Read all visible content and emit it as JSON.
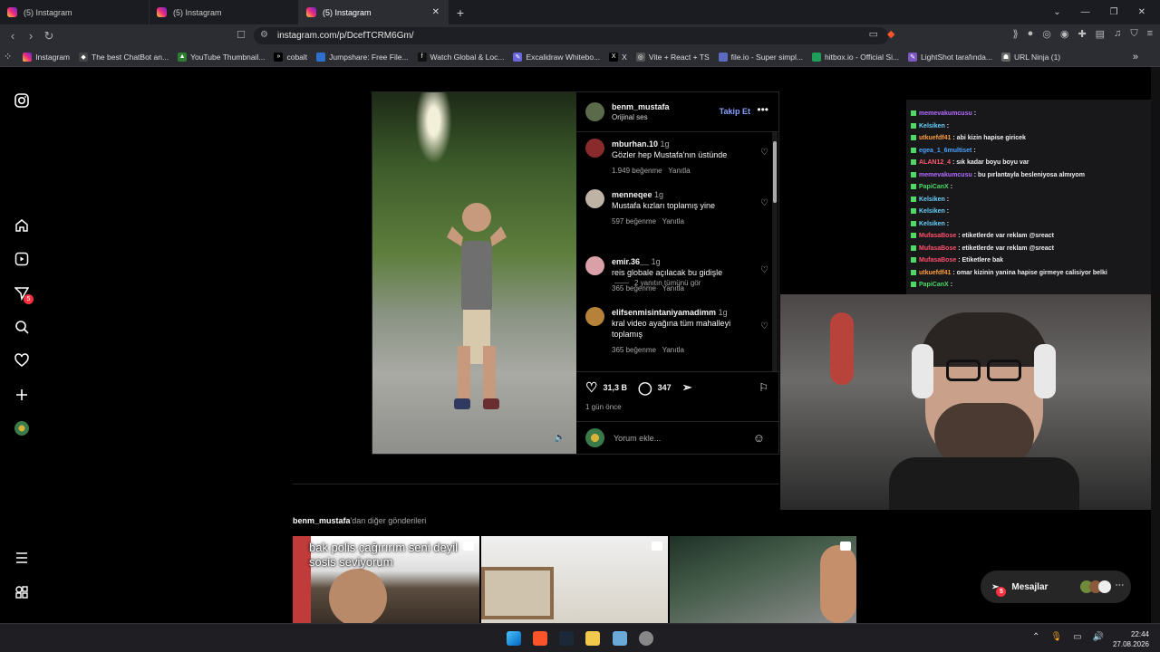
{
  "browser": {
    "tabs": [
      {
        "title": "(5) Instagram"
      },
      {
        "title": "(5) Instagram"
      },
      {
        "title": "(5) Instagram"
      }
    ],
    "url": "instagram.com/p/DcefTCRM6Gm/",
    "bookmarks": [
      "Instagram",
      "The best ChatBot an...",
      "YouTube Thumbnail...",
      "cobalt",
      "Jumpshare: Free File...",
      "Watch Global & Loc...",
      "Excalidraw Whitebo...",
      "X",
      "Vite + React + TS",
      "file.io - Super simpl...",
      "hitbox.io - Official Si...",
      "LightShot tarafında...",
      "URL Ninja (1)"
    ]
  },
  "sidebar": {
    "notif_badge": "5"
  },
  "post": {
    "author": "benm_mustafa",
    "audio": "Orijinal ses",
    "follow_label": "Takip Et",
    "comments": [
      {
        "user": "mburhan.10",
        "time": "1g",
        "text": "Gözler hep Mustafa'nın üstünde",
        "likes": "1.949 beğenme",
        "reply": "Yanıtla"
      },
      {
        "user": "menneqee",
        "time": "1g",
        "text": "Mustafa kızları toplamış yine",
        "likes": "597 beğenme",
        "reply": "Yanıtla"
      },
      {
        "user": "emir.36__",
        "time": "1g",
        "text": "reis globale açılacak bu gidişle",
        "likes": "365 beğenme",
        "reply": "Yanıtla"
      },
      {
        "user": "elifsenmisintaniyamadimm",
        "time": "1g",
        "text": "kral video ayağına tüm mahalleyi toplamış",
        "likes": "365 beğenme",
        "reply": "Yanıtla"
      }
    ],
    "view_replies": "2 yanıtın tümünü gör",
    "like_count": "31,3 B",
    "comment_count": "347",
    "ago": "1 gün önce",
    "comment_placeholder": "Yorum ekle..."
  },
  "more_posts": {
    "user": "benm_mustafa",
    "suffix": "'dan diğer gönderileri",
    "thumb1_text": "bak polis çağırırım seni deyil sosis seviyorum"
  },
  "stream_chat": [
    {
      "user": "memevakumcusu",
      "msg": ":",
      "color": "#b46bff"
    },
    {
      "user": "Kelsiken",
      "msg": ":",
      "color": "#6ad1ff"
    },
    {
      "user": "utkuefdf41",
      "msg": ": abi kizin hapise giricek",
      "color": "#ff9c3b"
    },
    {
      "user": "egea_1_6multiset",
      "msg": ":",
      "color": "#4aa3ff"
    },
    {
      "user": "ALAN12_4",
      "msg": ": sık kadar boyu boyu var",
      "color": "#ff5b6e"
    },
    {
      "user": "memevakumcusu",
      "msg": ": bu pırlantayla besleniyosa almıyom",
      "color": "#b46bff"
    },
    {
      "user": "PapiCanX",
      "msg": ":",
      "color": "#4cd964"
    },
    {
      "user": "Kelsiken",
      "msg": ":",
      "color": "#6ad1ff"
    },
    {
      "user": "Kelsiken",
      "msg": ":",
      "color": "#6ad1ff"
    },
    {
      "user": "Kelsiken",
      "msg": ":",
      "color": "#6ad1ff"
    },
    {
      "user": "MufasaBose",
      "msg": ": etiketlerde var reklam @sreact",
      "color": "#ff4f6b"
    },
    {
      "user": "MufasaBose",
      "msg": ": etiketlerde var reklam @sreact",
      "color": "#ff4f6b"
    },
    {
      "user": "MufasaBose",
      "msg": ": Etiketlere bak",
      "color": "#ff4f6b"
    },
    {
      "user": "utkuefdf41",
      "msg": ": omar kizinin yanina hapise girmeye calisiyor belki",
      "color": "#ff9c3b"
    },
    {
      "user": "PapiCanX",
      "msg": ":",
      "color": "#4cd964"
    }
  ],
  "messages": {
    "label": "Mesajlar",
    "badge": "5"
  },
  "taskbar": {
    "time": "22:44",
    "date": "27.08.2026"
  }
}
